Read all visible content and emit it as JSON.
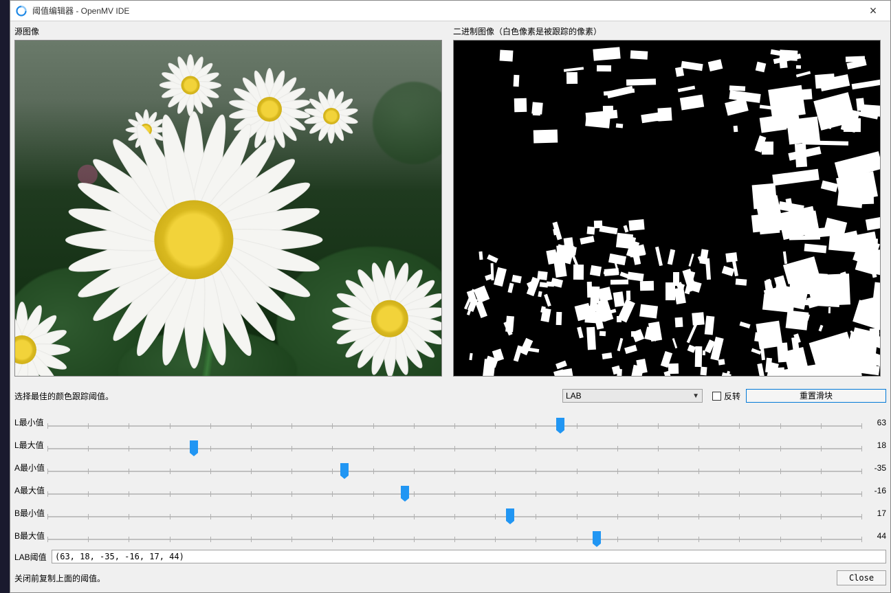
{
  "window": {
    "title": "阈值编辑器 - OpenMV IDE"
  },
  "panels": {
    "source_label": "源图像",
    "binary_label": "二进制图像（白色像素是被跟踪的像素）"
  },
  "instruction": "选择最佳的颜色跟踪阈值。",
  "colorspace": {
    "selected": "LAB"
  },
  "invert": {
    "label": "反转",
    "checked": false
  },
  "reset_button": "重置滑块",
  "sliders": [
    {
      "label": "L最小值",
      "value": 63,
      "min": 0,
      "max": 100
    },
    {
      "label": "L最大值",
      "value": 18,
      "min": 0,
      "max": 100
    },
    {
      "label": "A最小值",
      "value": -35,
      "min": -128,
      "max": 127
    },
    {
      "label": "A最大值",
      "value": -16,
      "min": -128,
      "max": 127
    },
    {
      "label": "B最小值",
      "value": 17,
      "min": -128,
      "max": 127
    },
    {
      "label": "B最大值",
      "value": 44,
      "min": -128,
      "max": 127
    }
  ],
  "lab_threshold": {
    "label": "LAB阈值",
    "value": "(63, 18, -35, -16, 17, 44)"
  },
  "footer_hint": "关闭前复制上面的阈值。",
  "close_button": "Close"
}
